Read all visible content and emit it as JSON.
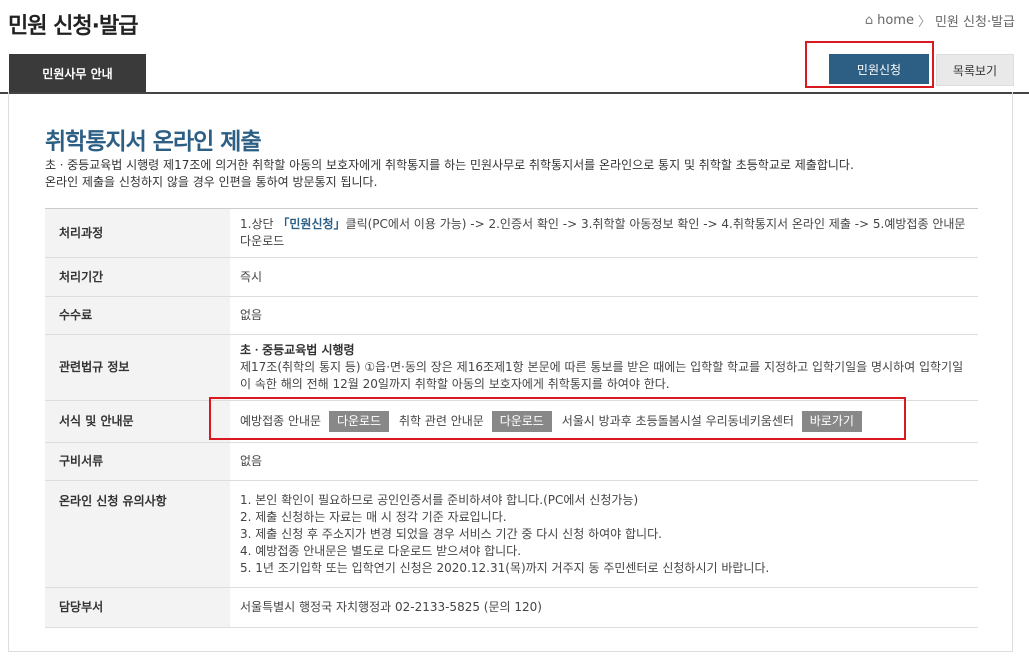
{
  "header": {
    "title": "민원 신청·발급",
    "breadcrumb": {
      "home": "home",
      "separator": "〉",
      "current": "민원 신청·발급"
    }
  },
  "tabs": {
    "active": "민원사무 안내"
  },
  "actions": {
    "apply": "민원신청",
    "list": "목록보기"
  },
  "main": {
    "heading": "취학통지서 온라인 제출",
    "intro": [
      "초ㆍ중등교육법 시행령 제17조에 의거한 취학할 아동의 보호자에게 취학통지를 하는 민원사무로 취학통지서를 온라인으로 통지 및 취학할 초등학교로 제출합니다.",
      "온라인 제출을 신청하지 않을 경우 인편을 통하여 방문통지 됩니다."
    ]
  },
  "table": {
    "process": {
      "label": "처리과정",
      "pre": "1.상단 ",
      "link": "「민원신청」",
      "post": "클릭(PC에서 이용 가능) -> 2.인증서 확인 -> 3.취학할 아동정보 확인 -> 4.취학통지서 온라인 제출 -> 5.예방접종 안내문 다운로드"
    },
    "period": {
      "label": "처리기간",
      "value": "즉시"
    },
    "fee": {
      "label": "수수료",
      "value": "없음"
    },
    "law": {
      "label": "관련법규 정보",
      "title": "초ㆍ중등교육법 시행령",
      "text": "제17조(취학의 통지 등) ①읍·면·동의 장은 제16조제1항 본문에 따른 통보를 받은 때에는 입학할 학교를 지정하고 입학기일을 명시하여 입학기일이 속한 해의 전해 12월 20일까지 취학할 아동의 보호자에게 취학통지를 하여야 한다."
    },
    "forms": {
      "label": "서식 및 안내문",
      "item1": "예방접종 안내문",
      "item1_btn": "다운로드",
      "item2": "취학 관련 안내문",
      "item2_btn": "다운로드",
      "item3": "서울시 방과후 초등돌봄시설 우리동네키움센터",
      "item3_btn": "바로가기"
    },
    "docs": {
      "label": "구비서류",
      "value": "없음"
    },
    "notes": {
      "label": "온라인 신청 유의사항",
      "items": [
        "1. 본인 확인이 필요하므로 공인인증서를 준비하셔야 합니다.(PC에서 신청가능)",
        "2. 제출 신청하는 자료는 매 시 정각 기준 자료입니다.",
        "3. 제출 신청 후 주소지가 변경 되었을 경우 서비스 기간 중 다시 신청 하여야 합니다.",
        "4. 예방접종 안내문은 별도로 다운로드 받으셔야 합니다.",
        "5. 1년 조기입학 또는 입학연기 신청은 2020.12.31(목)까지 거주지 동 주민센터로 신청하시기 바랍니다."
      ]
    },
    "dept": {
      "label": "담당부서",
      "value": "서울특별시 행정국 자치행정과 02-2133-5825 (문의 120)"
    }
  }
}
